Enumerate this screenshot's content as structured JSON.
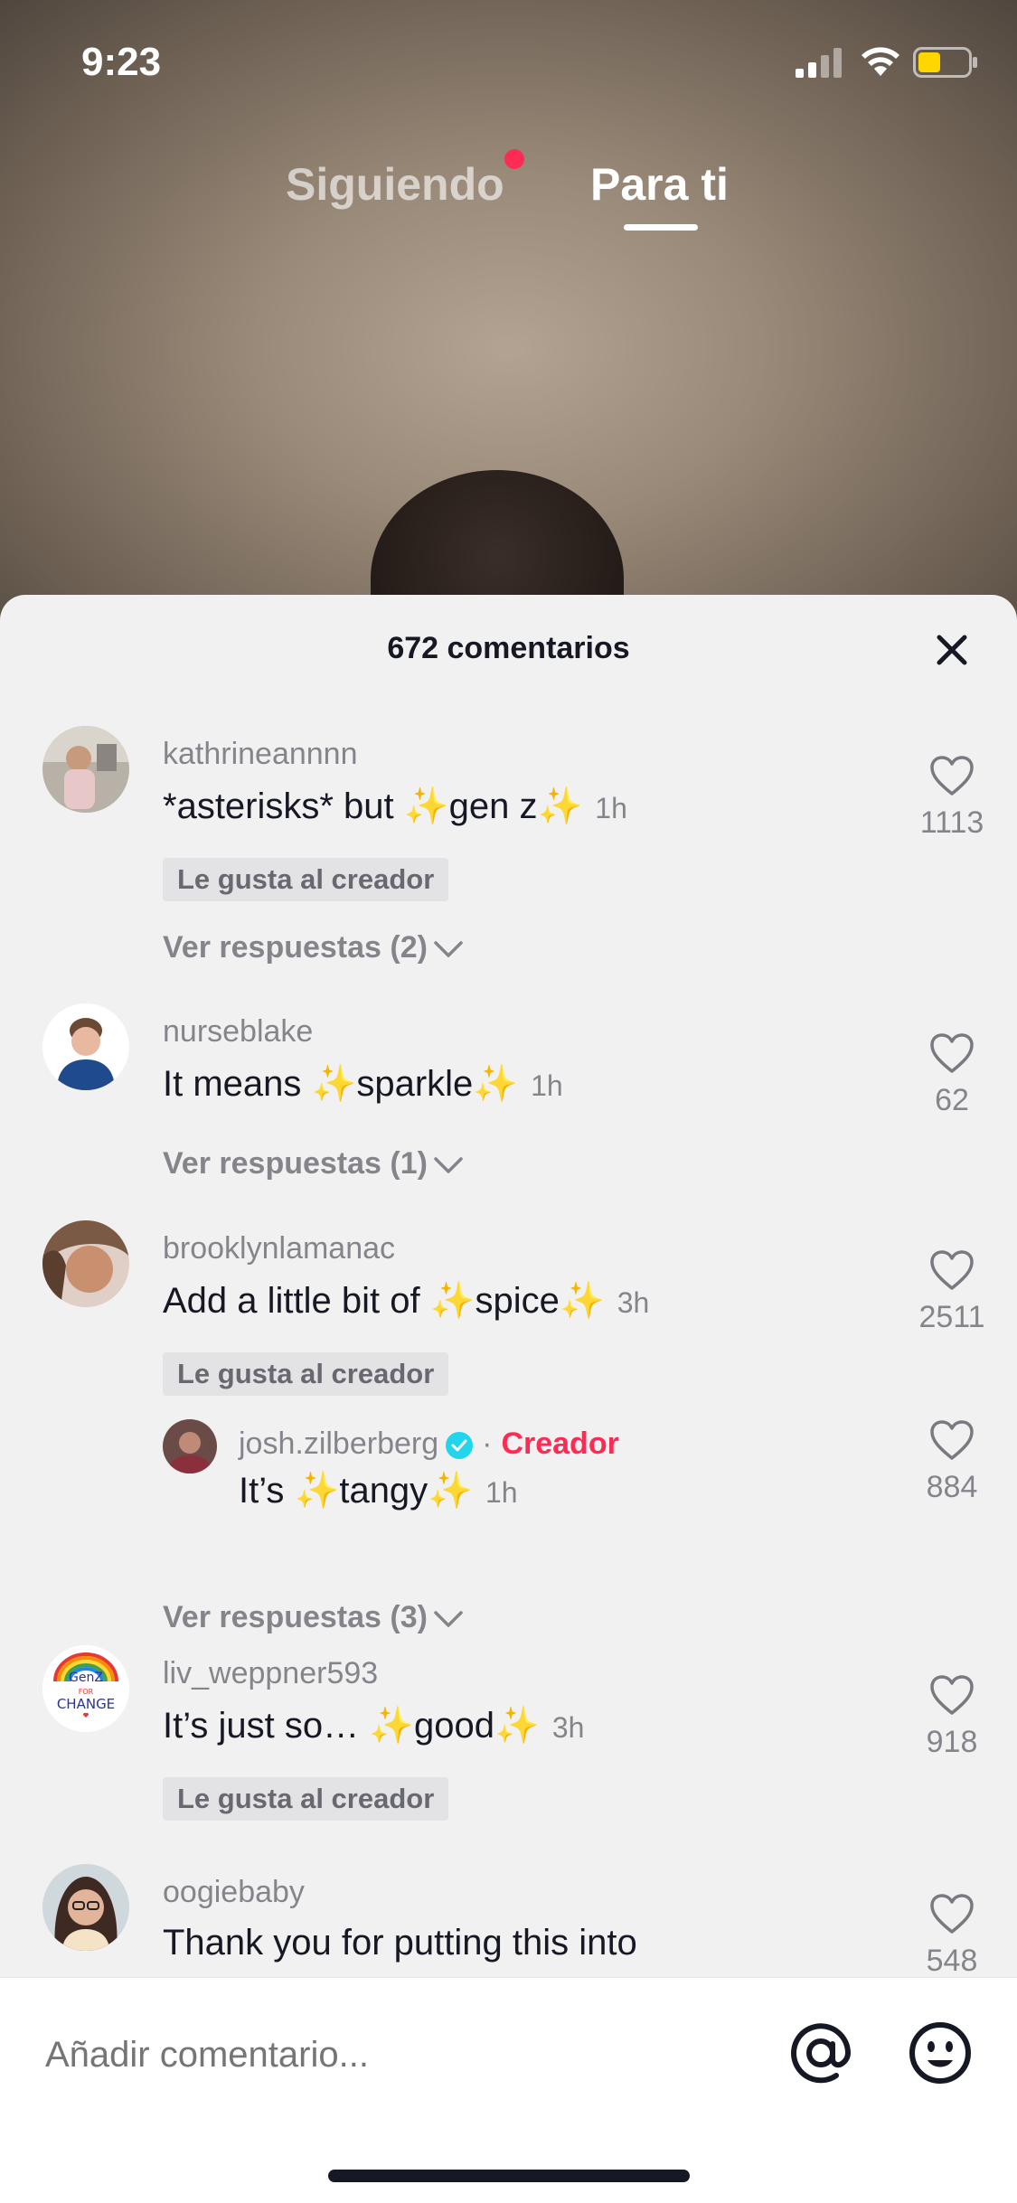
{
  "status_bar": {
    "time": "9:23",
    "battery_color": "#ffd600"
  },
  "top_tabs": {
    "following": "Siguiendo",
    "for_you": "Para ti",
    "accent": "#fe2c55"
  },
  "sheet": {
    "title": "672 comentarios",
    "close_icon": "close-icon"
  },
  "comments": [
    {
      "username": "kathrineannnn",
      "text_before": "*asterisks* but ",
      "word": "gen z",
      "text_after": "",
      "time": "1h",
      "creator_liked": "Le gusta al creador",
      "replies": "Ver respuestas (2)",
      "likes": "1113"
    },
    {
      "username": "nurseblake",
      "text_before": "It means ",
      "word": "sparkle",
      "text_after": "",
      "time": "1h",
      "replies": "Ver respuestas (1)",
      "likes": "62"
    },
    {
      "username": "brooklynlamanac",
      "text_before": "Add a little bit of ",
      "word": "spice",
      "text_after": "",
      "time": "3h",
      "creator_liked": "Le gusta al creador",
      "replies": "Ver respuestas (3)",
      "likes": "2511",
      "reply": {
        "username": "josh.zilberberg",
        "role": "Creador",
        "text_before": "It’s ",
        "word": "tangy",
        "time": "1h",
        "likes": "884"
      }
    },
    {
      "username": "liv_weppner593",
      "text_before": "It’s just so… ",
      "word": "good",
      "text_after": "",
      "time": "3h",
      "creator_liked": "Le gusta al creador",
      "likes": "918",
      "avatar_text": [
        "GenZ",
        "FOR",
        "CHANGE"
      ]
    },
    {
      "username": "oogiebaby",
      "text_before": "Thank you for putting this into",
      "likes": "548"
    }
  ],
  "sparkles": "✨",
  "input": {
    "placeholder": "Añadir comentario...",
    "mention_icon": "at-icon",
    "emoji_icon": "emoji-icon"
  }
}
